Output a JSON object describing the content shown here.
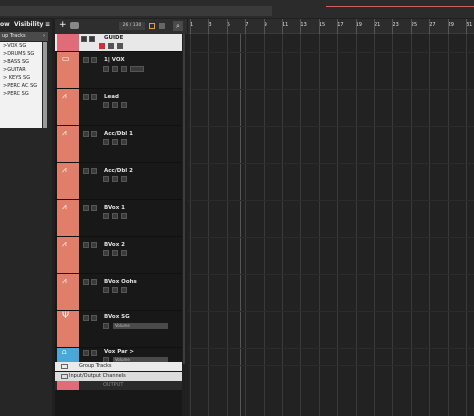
{
  "top": {
    "title": ""
  },
  "left_panel": {
    "tabs": [
      "ow",
      "Visibility",
      "≡"
    ],
    "group_header": "up Tracks",
    "group_tracks": [
      ">VOX SG",
      ">DRUMS SG",
      ">BASS SG",
      ">GUITAR",
      "> KEYS SG",
      ">PERC AC SG",
      ">PERC SG"
    ]
  },
  "toolbar": {
    "add": "+",
    "counter": "26 / 130"
  },
  "tracks": [
    {
      "name": "GUIDE",
      "color": "#e26b7a",
      "icon": "audio-wave-icon"
    },
    {
      "name": "1| VOX",
      "color": "#e07e6a",
      "icon": "folder-icon"
    },
    {
      "name": "Lead",
      "color": "#e07e6a",
      "icon": "audio-wave-icon"
    },
    {
      "name": "Acc/Dbl 1",
      "color": "#e07e6a",
      "icon": "audio-wave-icon"
    },
    {
      "name": "Acc/Dbl 2",
      "color": "#e07e6a",
      "icon": "audio-wave-icon"
    },
    {
      "name": "BVox 1",
      "color": "#e07e6a",
      "icon": "audio-wave-icon"
    },
    {
      "name": "BVox 2",
      "color": "#e07e6a",
      "icon": "audio-wave-icon"
    },
    {
      "name": "BVox Oohs",
      "color": "#e07e6a",
      "icon": "audio-wave-icon"
    },
    {
      "name": "BVox SG",
      "color": "#e07e6a",
      "icon": "group-channel-icon",
      "field": "Volume"
    },
    {
      "name": "Vox Par >",
      "color": "#4aa8d8",
      "icon": "fx-channel-icon",
      "field": "Volume"
    }
  ],
  "folders": [
    "Group Tracks",
    "Input/Output Channels",
    "OUTPUT"
  ],
  "ruler": {
    "bars": [
      "1",
      "3",
      "5",
      "7",
      "9",
      "11",
      "13",
      "15",
      "17",
      "19",
      "21",
      "23",
      "25",
      "27",
      "29",
      "31"
    ]
  }
}
